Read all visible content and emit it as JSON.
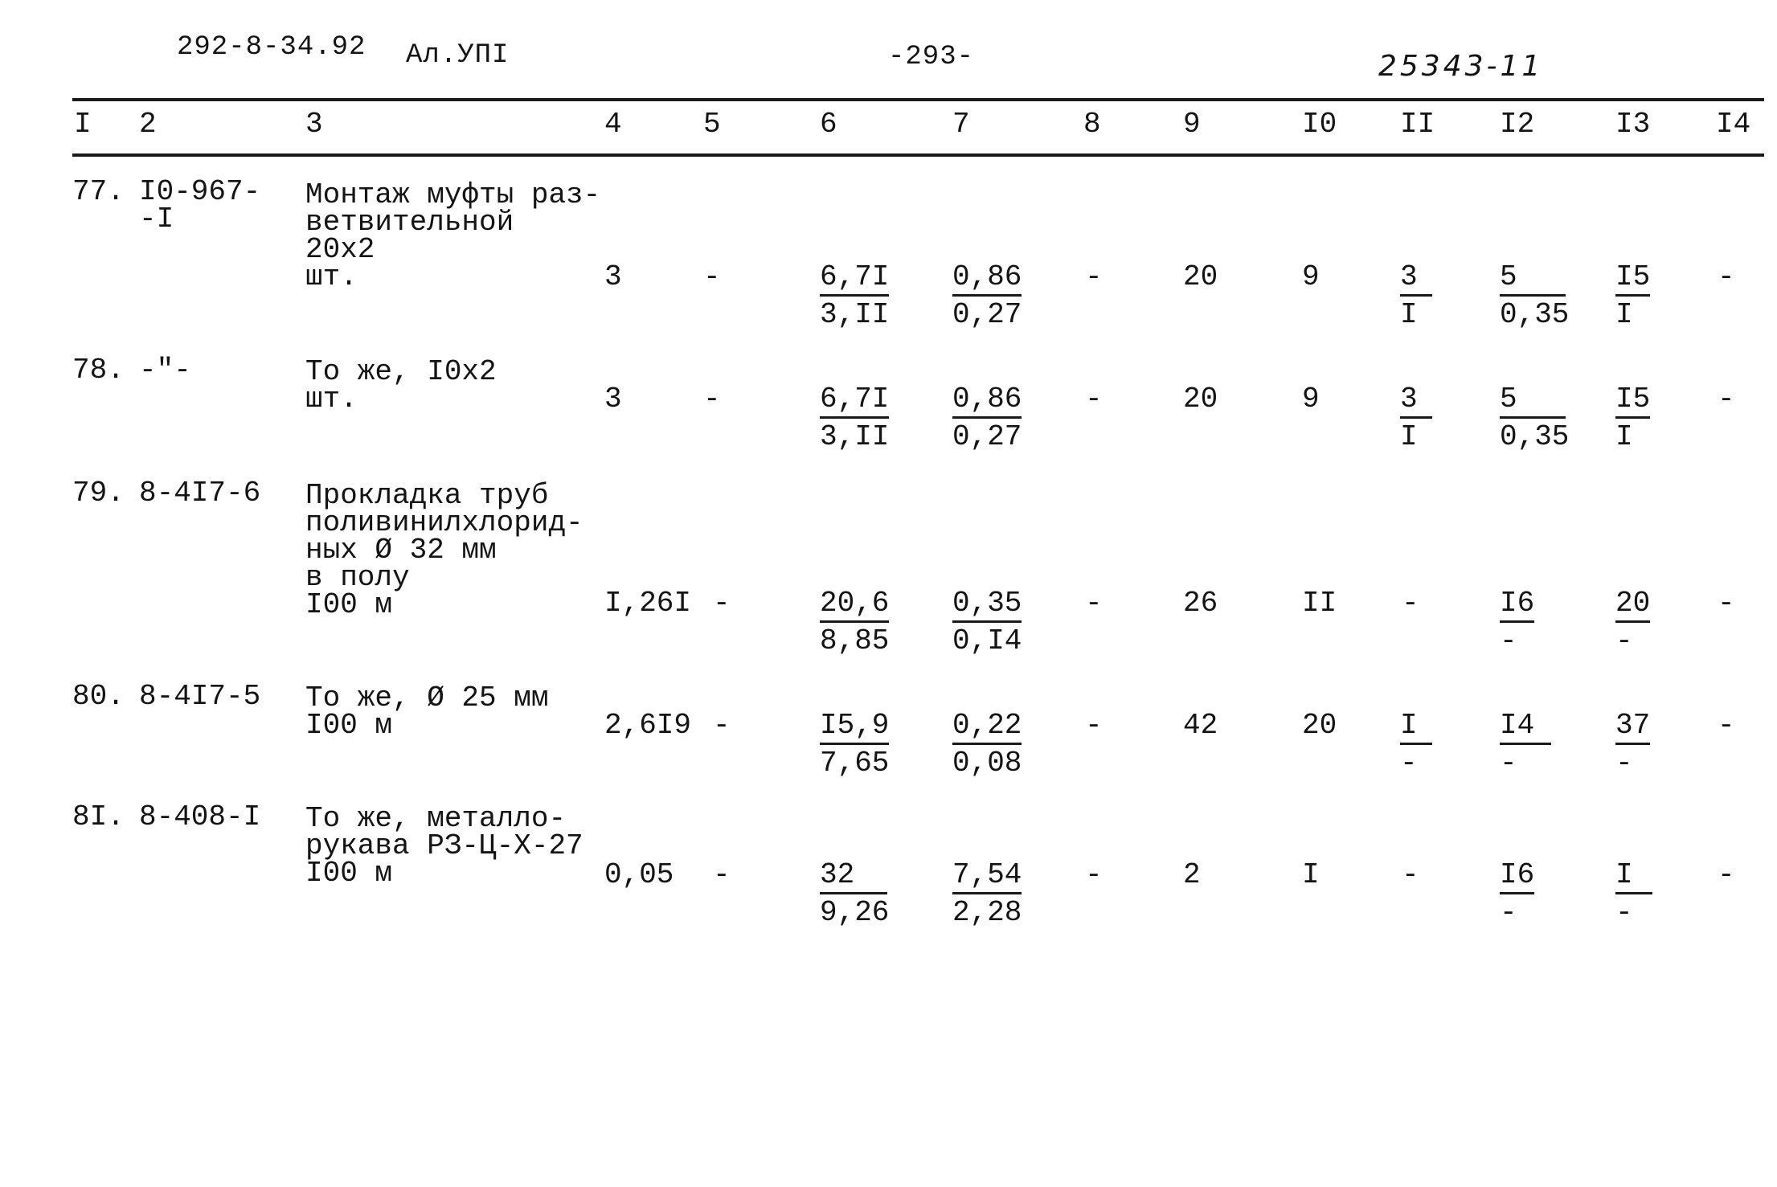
{
  "header": {
    "doc_code": "292-8-34.92",
    "album": "Ал.УПI",
    "page": "-293-",
    "handwritten_number": "25343-11"
  },
  "columns": [
    "I",
    "2",
    "3",
    "4",
    "5",
    "6",
    "7",
    "8",
    "9",
    "I0",
    "II",
    "I2",
    "I3",
    "I4"
  ],
  "rows": [
    {
      "num": "77.",
      "code": "I0-967-\n-I",
      "desc": "Монтаж муфты раз-\nветвительной\n20х2\nшт.",
      "c4": "3",
      "c5": "-",
      "c6": {
        "top": "6,7I",
        "bottom": "3,II"
      },
      "c7": {
        "top": "0,86",
        "bottom": "0,27"
      },
      "c8": "-",
      "c9": "20",
      "c10": "9",
      "c11": {
        "top": "3",
        "bottom": "I"
      },
      "c12": {
        "top": "5",
        "bottom": "0,35"
      },
      "c13": {
        "top": "I5",
        "bottom": "I"
      },
      "c14": "-"
    },
    {
      "num": "78.",
      "code": "-\"-",
      "desc": "То же, I0х2\nшт.",
      "c4": "3",
      "c5": "-",
      "c6": {
        "top": "6,7I",
        "bottom": "3,II"
      },
      "c7": {
        "top": "0,86",
        "bottom": "0,27"
      },
      "c8": "-",
      "c9": "20",
      "c10": "9",
      "c11": {
        "top": "3",
        "bottom": "I"
      },
      "c12": {
        "top": "5",
        "bottom": "0,35"
      },
      "c13": {
        "top": "I5",
        "bottom": "I"
      },
      "c14": "-"
    },
    {
      "num": "79.",
      "code": "8-4I7-6",
      "desc": "Прокладка труб\nполивинилхлорид-\nных Ø 32 мм\nв полу\nI00 м",
      "c4": "I,26I",
      "c5": "-",
      "c6": {
        "top": "20,6",
        "bottom": "8,85"
      },
      "c7": {
        "top": "0,35",
        "bottom": "0,I4"
      },
      "c8": "-",
      "c9": "26",
      "c10": "II",
      "c11": "-",
      "c12": {
        "top": "I6",
        "bottom": "-"
      },
      "c13": {
        "top": "20",
        "bottom": "-"
      },
      "c14": "-"
    },
    {
      "num": "80.",
      "code": "8-4I7-5",
      "desc": "То же, Ø 25 мм\nI00 м",
      "c4": "2,6I9",
      "c5": "-",
      "c6": {
        "top": "I5,9",
        "bottom": "7,65"
      },
      "c7": {
        "top": "0,22",
        "bottom": "0,08"
      },
      "c8": "-",
      "c9": "42",
      "c10": "20",
      "c11": {
        "top": "I",
        "bottom": "-"
      },
      "c12": {
        "top": "I4",
        "bottom": "-"
      },
      "c13": {
        "top": "37",
        "bottom": "-"
      },
      "c14": "-"
    },
    {
      "num": "8I.",
      "code": "8-408-I",
      "desc": "То же, металло-\nрукава РЗ-Ц-Х-27\nI00 м",
      "c4": "0,05",
      "c5": "-",
      "c6": {
        "top": "32",
        "bottom": "9,26"
      },
      "c7": {
        "top": "7,54",
        "bottom": "2,28"
      },
      "c8": "-",
      "c9": "2",
      "c10": "I",
      "c11": "-",
      "c12": {
        "top": "I6",
        "bottom": "-"
      },
      "c13": {
        "top": "I",
        "bottom": "-"
      },
      "c14": "-"
    }
  ]
}
